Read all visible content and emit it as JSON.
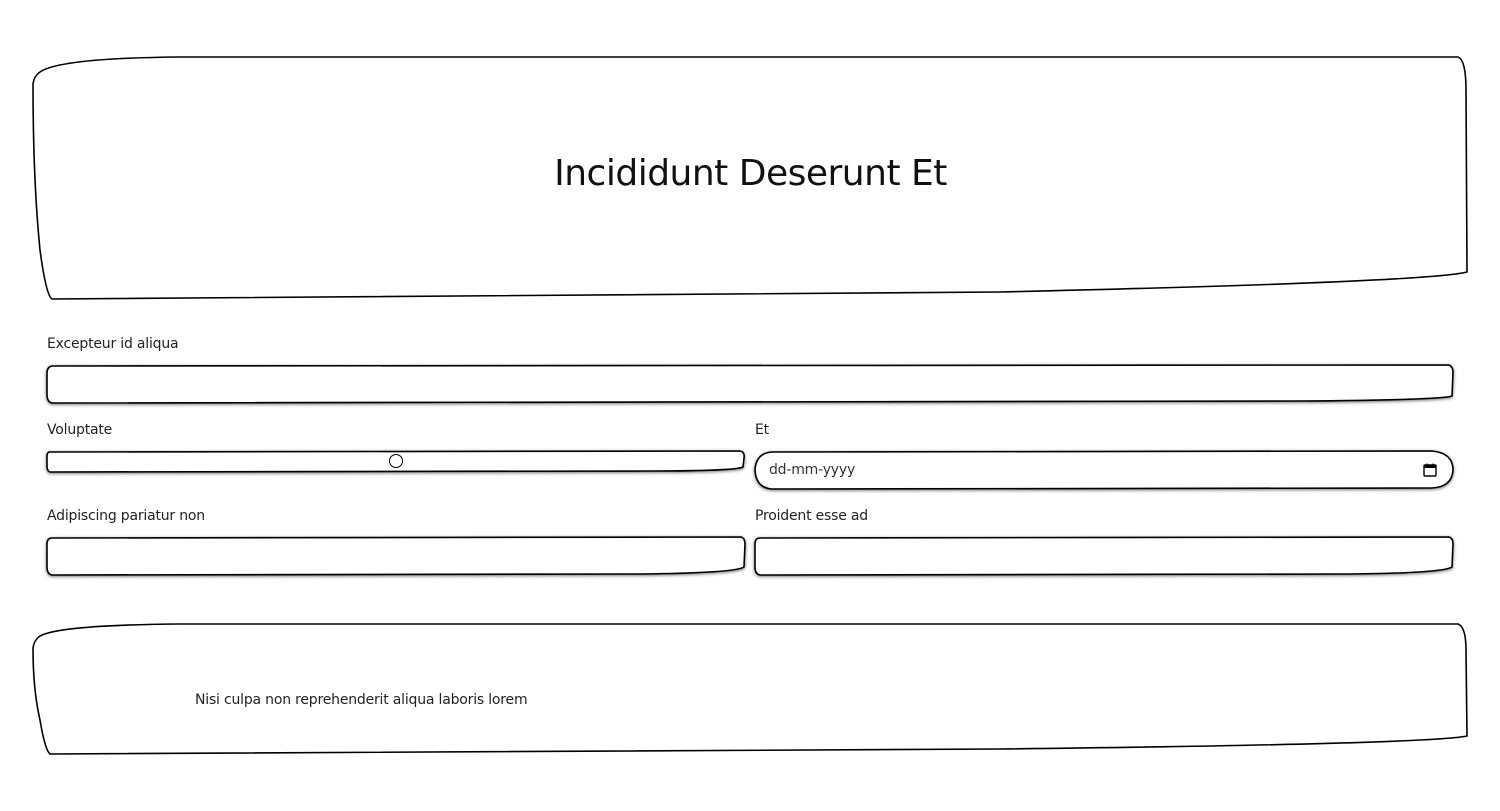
{
  "header": {
    "title": "Incididunt Deserunt Et"
  },
  "form": {
    "field1": {
      "label": "Excepteur id aliqua",
      "value": ""
    },
    "slider": {
      "label": "Voluptate",
      "value_fraction": 0.5
    },
    "date": {
      "label": "Et",
      "placeholder": "dd-mm-yyyy",
      "icon": "calendar-icon"
    },
    "field3": {
      "label": "Adipiscing pariatur non",
      "value": ""
    },
    "field4": {
      "label": "Proident esse ad",
      "value": ""
    }
  },
  "footer": {
    "text": "Nisi culpa non reprehenderit aliqua laboris lorem"
  }
}
